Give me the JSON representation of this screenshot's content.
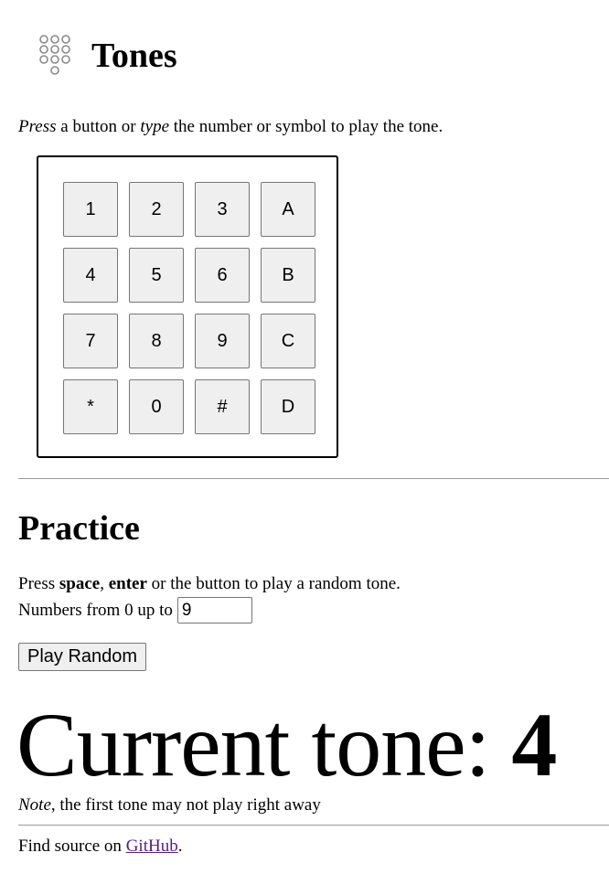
{
  "header": {
    "icon": "dialpad-icon",
    "title": "Tones"
  },
  "intro": {
    "press": "Press",
    "text1": " a button or ",
    "type": "type",
    "text2": " the number or symbol to play the tone."
  },
  "keypad": {
    "keys": [
      [
        "1",
        "2",
        "3",
        "A"
      ],
      [
        "4",
        "5",
        "6",
        "B"
      ],
      [
        "7",
        "8",
        "9",
        "C"
      ],
      [
        "*",
        "0",
        "#",
        "D"
      ]
    ]
  },
  "practice": {
    "title": "Practice",
    "line1_prefix": "Press ",
    "space": "space",
    "comma": ", ",
    "enter": "enter",
    "line1_suffix": " or the button to play a random tone.",
    "range_label": "Numbers from 0 up to",
    "max_value": "9",
    "play_button": "Play Random"
  },
  "current": {
    "label": "Current tone: ",
    "value": "4"
  },
  "note": {
    "emph": "Note",
    "text": ", the first tone may not play right away"
  },
  "footer": {
    "prefix": "Find source on ",
    "link": "GitHub",
    "suffix": ".",
    "link_color": "#551a8b"
  }
}
